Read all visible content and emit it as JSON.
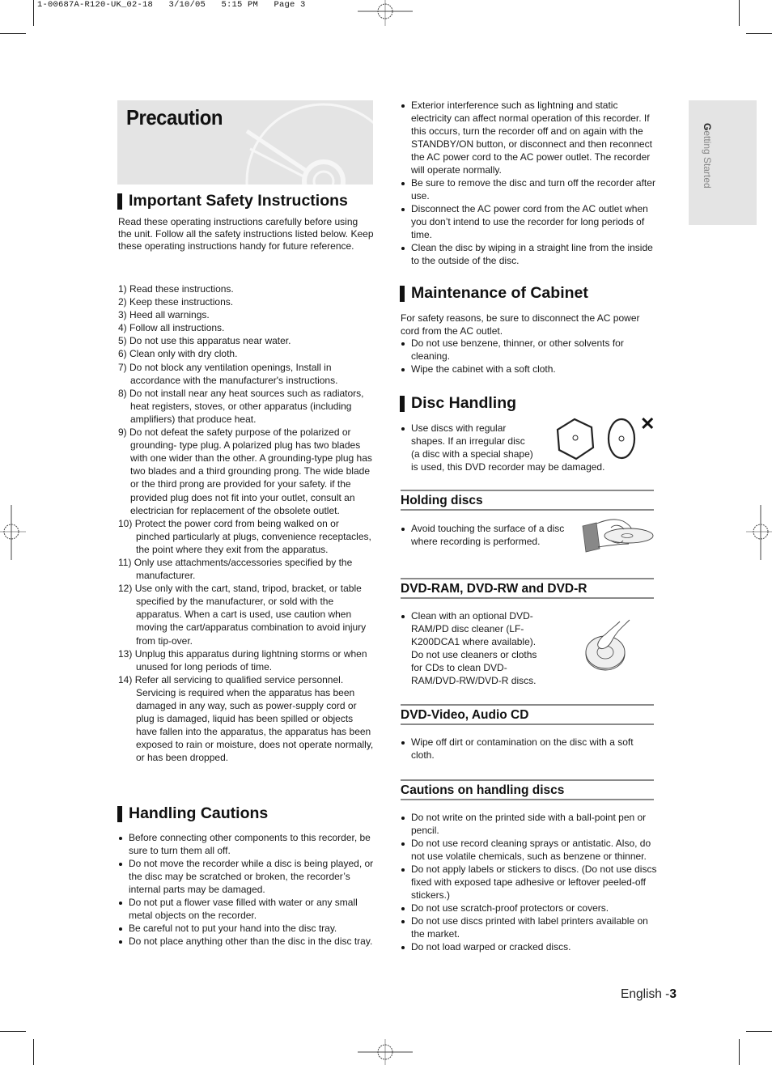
{
  "slug": "1-00687A-R120-UK_02-18   3/10/05   5:15 PM   Page 3",
  "hero": {
    "title": "Precaution"
  },
  "side_tab": {
    "first_letter": "G",
    "rest": "etting Started"
  },
  "important": {
    "title": "Important Safety Instructions",
    "intro": "Read these operating instructions carefully before using the unit. Follow all the safety instructions listed below. Keep these operating instructions handy for future reference.",
    "items": [
      {
        "n": "1)",
        "text": "Read these instructions."
      },
      {
        "n": "2)",
        "text": "Keep these instructions."
      },
      {
        "n": "3)",
        "text": "Heed all warnings."
      },
      {
        "n": "4)",
        "text": "Follow all instructions."
      },
      {
        "n": "5)",
        "text": "Do not use this apparatus near water."
      },
      {
        "n": "6)",
        "text": "Clean only with dry cloth."
      },
      {
        "n": "7)",
        "text": "Do not block any ventilation openings, Install in accordance with the manufacturer's instructions."
      },
      {
        "n": "8)",
        "text": "Do not install near any heat sources such as radiators, heat registers, stoves, or other apparatus (including amplifiers) that produce heat."
      },
      {
        "n": "9)",
        "text": "Do not defeat the safety purpose of the polarized or grounding- type plug. A polarized plug has two blades with one wider than the other. A grounding-type plug has two blades and a third grounding prong. The wide blade or the third prong are provided for your safety. if the provided plug does not fit into your outlet, consult an electrician for replacement of the obsolete outlet."
      },
      {
        "n": "10)",
        "text": "Protect the power cord from being walked on or pinched particularly at plugs, convenience receptacles, the point where they exit from the apparatus."
      },
      {
        "n": "11)",
        "text": "Only use attachments/accessories specified by the manufacturer."
      },
      {
        "n": "12)",
        "text": "Use only with the cart, stand, tripod, bracket, or table specified by the manufacturer, or sold with the apparatus. When a cart is used, use caution when moving the cart/apparatus combination to avoid injury from tip-over."
      },
      {
        "n": "13)",
        "text": "Unplug this apparatus during lightning storms or when unused for long periods of time."
      },
      {
        "n": "14)",
        "text": "Refer all servicing to qualified service personnel. Servicing is required when the apparatus has been damaged in any way, such as power-supply cord or plug is damaged, liquid has been spilled or objects have fallen into the apparatus, the apparatus has been exposed to rain or moisture, does not operate normally, or has been dropped."
      }
    ]
  },
  "handling": {
    "title": "Handling Cautions",
    "items": [
      "Before connecting other components to this recorder, be sure to turn them all off.",
      "Do not move the recorder while a disc is being played, or the disc may be scratched or broken, the recorder’s internal parts may be damaged.",
      "Do not put a flower vase filled with water or any small metal objects on the recorder.",
      "Be careful not to put your hand into the disc tray.",
      "Do not place anything other than the disc in the disc tray."
    ]
  },
  "handling_cont": {
    "items": [
      "Exterior interference such as lightning and static electricity can affect normal operation of this recorder. If this occurs, turn the recorder off and on again with the STANDBY/ON button, or disconnect and then reconnect the AC power cord to the AC power outlet. The recorder will operate normally.",
      "Be sure to remove the disc and turn off the recorder after use.",
      "Disconnect the AC power cord from the AC outlet when you don’t intend to use the recorder for long periods of time.",
      "Clean the disc by wiping in a straight line from the inside to the outside of the disc."
    ]
  },
  "cabinet": {
    "title": "Maintenance of Cabinet",
    "intro": "For safety reasons, be sure to disconnect the AC power cord from the AC outlet.",
    "items": [
      "Do not use benzene, thinner, or other solvents for cleaning.",
      "Wipe the cabinet with a soft cloth."
    ]
  },
  "disc_handling": {
    "title": "Disc Handling",
    "items": [
      "Use discs with regular shapes. If an irregular disc (a disc with a special shape) is used, this DVD recorder may be damaged."
    ],
    "lines": [
      "Use discs with regular",
      "shapes. If an irregular disc",
      "(a disc with a special shape)",
      "is used, this DVD recorder may be damaged."
    ],
    "icon_cross": "✕"
  },
  "holding": {
    "title": "Holding discs",
    "items": [
      "Avoid touching the surface of a disc where recording is performed."
    ]
  },
  "dvd_ram": {
    "title": "DVD-RAM, DVD-RW and DVD-R",
    "items": [
      "Clean with an optional DVD-RAM/PD disc cleaner (LF-K200DCA1 where available). Do not use cleaners or cloths for CDs to clean DVD-RAM/DVD-RW/DVD-R discs."
    ]
  },
  "dvd_video": {
    "title": "DVD-Video, Audio CD",
    "items": [
      "Wipe off dirt or contamination on the disc with a soft cloth."
    ]
  },
  "cautions_discs": {
    "title": "Cautions on handling discs",
    "items": [
      "Do not write on the printed side with a ball-point pen or pencil.",
      "Do not use record cleaning sprays or antistatic. Also, do not use volatile chemicals, such as benzene or thinner.",
      "Do not apply labels or stickers to discs. (Do not use discs fixed with exposed tape adhesive or leftover peeled-off stickers.)",
      "Do not use scratch-proof protectors or covers.",
      "Do not use discs printed with label printers available on the market.",
      "Do not load warped or cracked discs."
    ]
  },
  "footer": {
    "prefix": "English -",
    "page": "3"
  }
}
